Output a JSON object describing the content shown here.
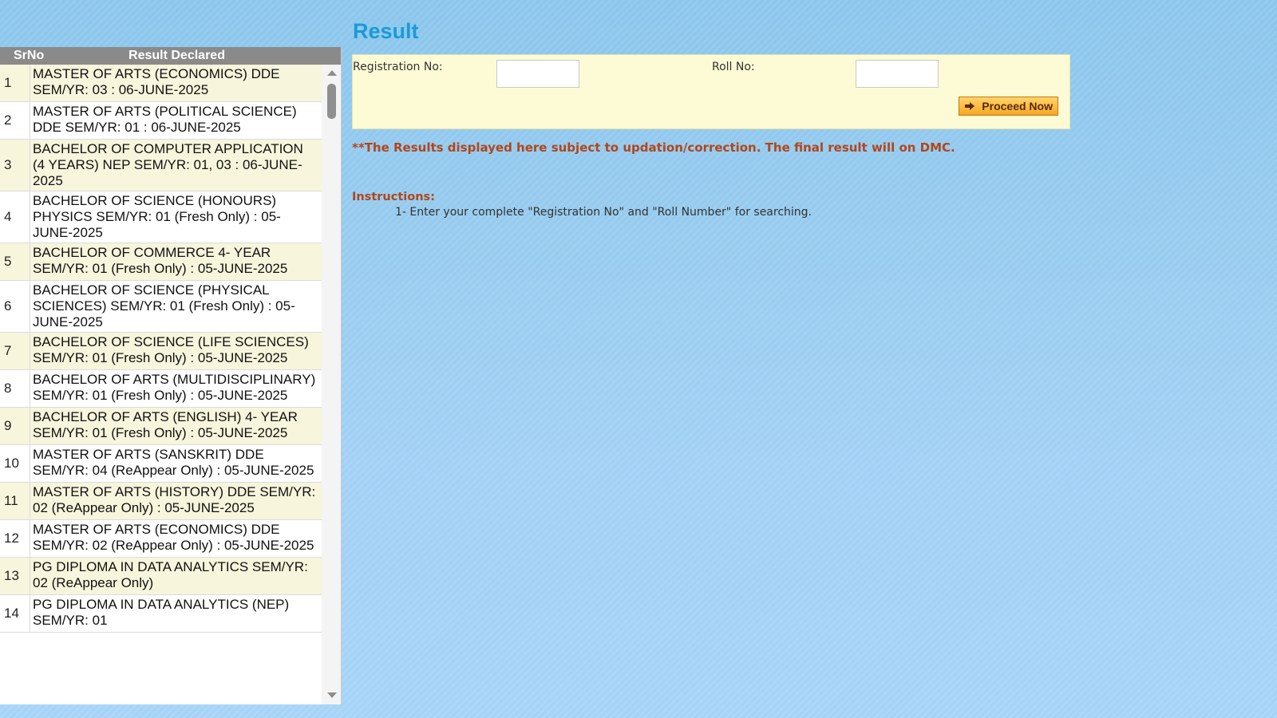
{
  "results_list": {
    "headers": {
      "srno": "SrNo",
      "result": "Result Declared"
    },
    "rows": [
      {
        "srno": "1",
        "result": "MASTER OF ARTS (ECONOMICS) DDE SEM/YR: 03 : 06-JUNE-2025"
      },
      {
        "srno": "2",
        "result": "MASTER OF ARTS (POLITICAL SCIENCE) DDE SEM/YR: 01 : 06-JUNE-2025"
      },
      {
        "srno": "3",
        "result": "BACHELOR OF COMPUTER APPLICATION (4 YEARS) NEP SEM/YR: 01, 03 : 06-JUNE-2025"
      },
      {
        "srno": "4",
        "result": "BACHELOR OF SCIENCE (HONOURS) PHYSICS SEM/YR: 01 (Fresh Only) : 05-JUNE-2025"
      },
      {
        "srno": "5",
        "result": "BACHELOR OF COMMERCE 4- YEAR SEM/YR: 01 (Fresh Only) : 05-JUNE-2025"
      },
      {
        "srno": "6",
        "result": "BACHELOR OF SCIENCE (PHYSICAL SCIENCES) SEM/YR: 01 (Fresh Only) : 05-JUNE-2025"
      },
      {
        "srno": "7",
        "result": "BACHELOR OF SCIENCE (LIFE SCIENCES) SEM/YR: 01 (Fresh Only) : 05-JUNE-2025"
      },
      {
        "srno": "8",
        "result": "BACHELOR OF ARTS (MULTIDISCIPLINARY) SEM/YR: 01 (Fresh Only) : 05-JUNE-2025"
      },
      {
        "srno": "9",
        "result": "BACHELOR OF ARTS (ENGLISH) 4- YEAR SEM/YR: 01 (Fresh Only) : 05-JUNE-2025"
      },
      {
        "srno": "10",
        "result": "MASTER OF ARTS (SANSKRIT) DDE SEM/YR: 04 (ReAppear Only) : 05-JUNE-2025"
      },
      {
        "srno": "11",
        "result": "MASTER OF ARTS (HISTORY) DDE SEM/YR: 02 (ReAppear Only) : 05-JUNE-2025"
      },
      {
        "srno": "12",
        "result": "MASTER OF ARTS (ECONOMICS) DDE SEM/YR: 02 (ReAppear Only) : 05-JUNE-2025"
      },
      {
        "srno": "13",
        "result": "PG DIPLOMA IN DATA ANALYTICS SEM/YR: 02 (ReAppear Only)"
      },
      {
        "srno": "14",
        "result": "PG DIPLOMA IN DATA ANALYTICS (NEP) SEM/YR: 01"
      }
    ]
  },
  "result_form": {
    "title": "Result",
    "registration_label": "Registration No:",
    "registration_value": "",
    "roll_label": "Roll No:",
    "roll_value": "",
    "proceed_label": "Proceed Now"
  },
  "note": "**The Results displayed here subject to updation/correction. The final result will on DMC.",
  "instructions": {
    "title": "Instructions:",
    "items": [
      "1- Enter your complete \"Registration No\" and \"Roll Number\" for searching."
    ]
  },
  "colors": {
    "title": "#1a9bd7",
    "note": "#b2461b",
    "form_bg": "#fdfbd5",
    "header_bg": "#8a8a8a",
    "button": "#f6a823"
  },
  "icons": {
    "proceed": "arrow-right-icon",
    "scroll_up": "scroll-up-arrow-icon",
    "scroll_down": "scroll-down-arrow-icon"
  }
}
